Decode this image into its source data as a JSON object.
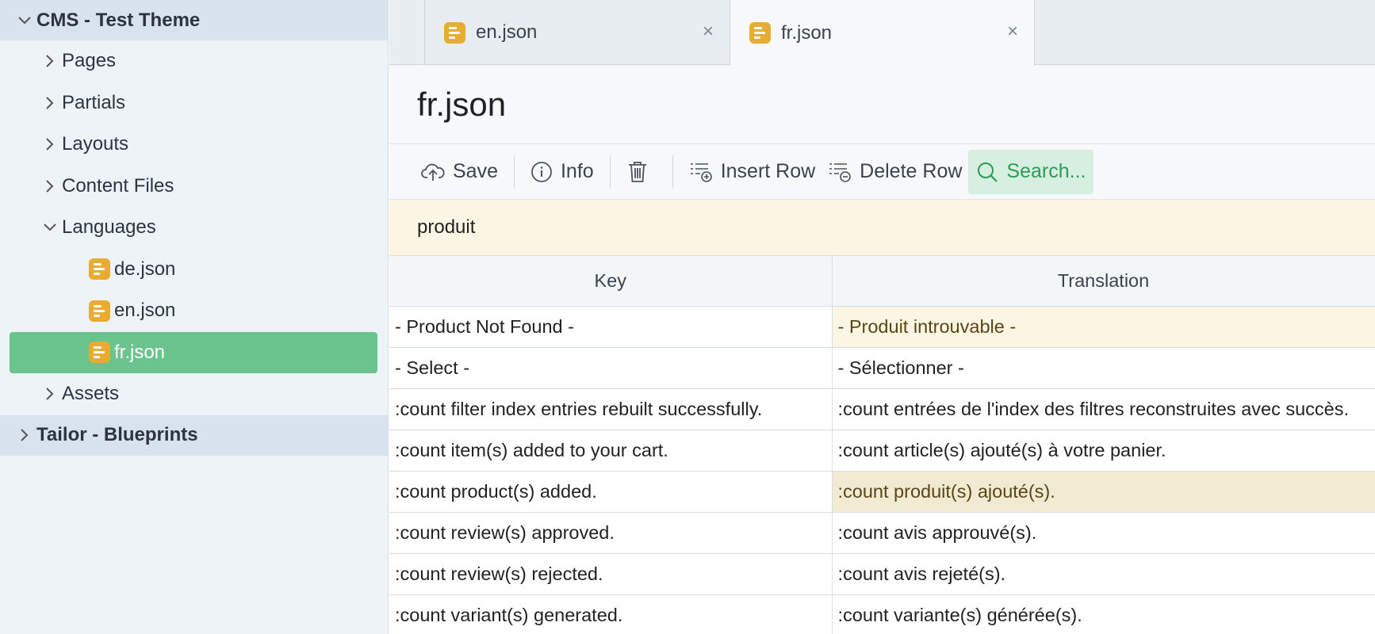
{
  "sidebar": {
    "groups": [
      {
        "label": "CMS - Test Theme"
      },
      {
        "label": "Tailor - Blueprints"
      }
    ],
    "items": [
      {
        "label": "Pages"
      },
      {
        "label": "Partials"
      },
      {
        "label": "Layouts"
      },
      {
        "label": "Content Files"
      },
      {
        "label": "Languages"
      },
      {
        "label": "de.json"
      },
      {
        "label": "en.json"
      },
      {
        "label": "fr.json"
      },
      {
        "label": "Assets"
      }
    ]
  },
  "tabs": [
    {
      "label": "en.json",
      "close": "×"
    },
    {
      "label": "fr.json",
      "close": "×"
    }
  ],
  "page_title": "fr.json",
  "toolbar": {
    "save": "Save",
    "info": "Info",
    "insert_row": "Insert Row",
    "delete_row": "Delete Row",
    "search": "Search..."
  },
  "search_value": "produit",
  "table": {
    "headers": {
      "key": "Key",
      "translation": "Translation"
    },
    "rows": [
      {
        "key": "- Product Not Found -",
        "translation": "- Produit introuvable -"
      },
      {
        "key": "- Select -",
        "translation": "- Sélectionner -"
      },
      {
        "key": ":count filter index entries rebuilt successfully.",
        "translation": ":count entrées de l'index des filtres reconstruites avec succès."
      },
      {
        "key": ":count item(s) added to your cart.",
        "translation": ":count article(s) ajouté(s) à votre panier."
      },
      {
        "key": ":count product(s) added.",
        "translation": ":count produit(s) ajouté(s)."
      },
      {
        "key": ":count review(s) approved.",
        "translation": ":count avis approuvé(s)."
      },
      {
        "key": ":count review(s) rejected.",
        "translation": ":count avis rejeté(s)."
      },
      {
        "key": ":count variant(s) generated.",
        "translation": ":count variante(s) générée(s)."
      }
    ]
  },
  "colors": {
    "accent": "#69c58d",
    "file_icon": "#e9ac33",
    "highlight": "#fbf5e4",
    "search_active": "#d6efe0"
  },
  "icons": [
    "chevron-down-icon",
    "chevron-right-icon",
    "file-icon",
    "close-icon",
    "cloud-upload-icon",
    "info-icon",
    "trash-icon",
    "insert-row-icon",
    "delete-row-icon",
    "search-icon"
  ]
}
